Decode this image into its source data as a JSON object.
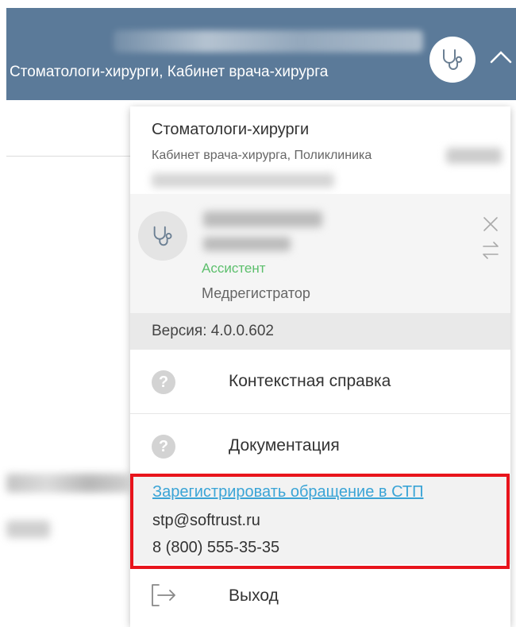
{
  "header": {
    "department_line": "Стоматологи-хирурги, Кабинет врача-хирурга",
    "avatar_icon": "stethoscope-icon",
    "toggle_icon": "chevron-up-icon",
    "background_color": "#5b7a99"
  },
  "panel": {
    "department": {
      "title": "Стоматологи-хирурги",
      "subtitle": "Кабинет врача-хирурга, Поликлиника"
    },
    "roles": {
      "avatar_icon": "stethoscope-icon",
      "active_role": "Ассистент",
      "other_role": "Медрегистратор",
      "active_color": "#5cbf6c"
    },
    "version": "Версия: 4.0.0.602",
    "menu": {
      "context_help": "Контекстная справка",
      "documentation": "Документация",
      "exit": "Выход"
    },
    "support": {
      "link": "Зарегистрировать обращение в СТП",
      "email": "stp@softrust.ru",
      "phone": "8 (800) 555-35-35",
      "highlight_color": "#e8141c"
    }
  }
}
